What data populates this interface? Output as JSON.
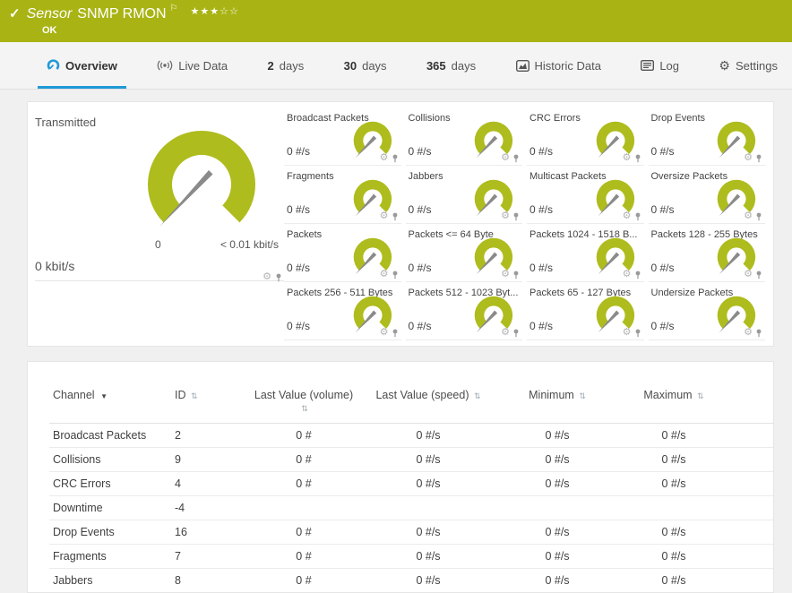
{
  "colors": {
    "brand_green": "#a9b414",
    "gauge_green": "#aebc1d",
    "accent_blue": "#1f9ad6",
    "needle_gray": "#8a8a8a"
  },
  "icons": {
    "check": "✓",
    "flag": "⚐",
    "gear": "⚙",
    "sort_both": "⇅",
    "sort_desc": "▼"
  },
  "header": {
    "title_prefix": "Sensor",
    "title": "SNMP RMON",
    "stars": "★★★☆☆",
    "status": "OK"
  },
  "tabs": [
    {
      "label": "Overview",
      "active": true
    },
    {
      "label": "Live Data"
    },
    {
      "num": "2",
      "label": "days"
    },
    {
      "num": "30",
      "label": "days"
    },
    {
      "num": "365",
      "label": "days"
    },
    {
      "label": "Historic Data"
    },
    {
      "label": "Log"
    },
    {
      "label": "Settings"
    }
  ],
  "main_gauge": {
    "label": "Transmitted",
    "value": "0 kbit/s",
    "scale_min": "0",
    "scale_max": "< 0.01 kbit/s"
  },
  "gauges": [
    {
      "label": "Broadcast Packets",
      "value": "0 #/s"
    },
    {
      "label": "Collisions",
      "value": "0 #/s"
    },
    {
      "label": "CRC Errors",
      "value": "0 #/s"
    },
    {
      "label": "Drop Events",
      "value": "0 #/s"
    },
    {
      "label": "Fragments",
      "value": "0 #/s"
    },
    {
      "label": "Jabbers",
      "value": "0 #/s"
    },
    {
      "label": "Multicast Packets",
      "value": "0 #/s"
    },
    {
      "label": "Oversize Packets",
      "value": "0 #/s"
    },
    {
      "label": "Packets",
      "value": "0 #/s"
    },
    {
      "label": "Packets <= 64 Byte",
      "value": "0 #/s"
    },
    {
      "label": "Packets 1024 - 1518 B...",
      "value": "0 #/s"
    },
    {
      "label": "Packets 128 - 255 Bytes",
      "value": "0 #/s"
    },
    {
      "label": "Packets 256 - 511 Bytes",
      "value": "0 #/s"
    },
    {
      "label": "Packets 512 - 1023 Byt...",
      "value": "0 #/s"
    },
    {
      "label": "Packets 65 - 127 Bytes",
      "value": "0 #/s"
    },
    {
      "label": "Undersize Packets",
      "value": "0 #/s"
    }
  ],
  "table": {
    "headers": {
      "channel": "Channel",
      "id": "ID",
      "last_value_volume": "Last Value (volume)",
      "last_value_speed": "Last Value (speed)",
      "minimum": "Minimum",
      "maximum": "Maximum"
    },
    "rows": [
      {
        "channel": "Broadcast Packets",
        "id": "2",
        "volume": "0 #",
        "speed": "0 #/s",
        "minimum": "0 #/s",
        "maximum": "0 #/s"
      },
      {
        "channel": "Collisions",
        "id": "9",
        "volume": "0 #",
        "speed": "0 #/s",
        "minimum": "0 #/s",
        "maximum": "0 #/s"
      },
      {
        "channel": "CRC Errors",
        "id": "4",
        "volume": "0 #",
        "speed": "0 #/s",
        "minimum": "0 #/s",
        "maximum": "0 #/s"
      },
      {
        "channel": "Downtime",
        "id": "-4",
        "volume": "",
        "speed": "",
        "minimum": "",
        "maximum": ""
      },
      {
        "channel": "Drop Events",
        "id": "16",
        "volume": "0 #",
        "speed": "0 #/s",
        "minimum": "0 #/s",
        "maximum": "0 #/s"
      },
      {
        "channel": "Fragments",
        "id": "7",
        "volume": "0 #",
        "speed": "0 #/s",
        "minimum": "0 #/s",
        "maximum": "0 #/s"
      },
      {
        "channel": "Jabbers",
        "id": "8",
        "volume": "0 #",
        "speed": "0 #/s",
        "minimum": "0 #/s",
        "maximum": "0 #/s"
      }
    ]
  }
}
